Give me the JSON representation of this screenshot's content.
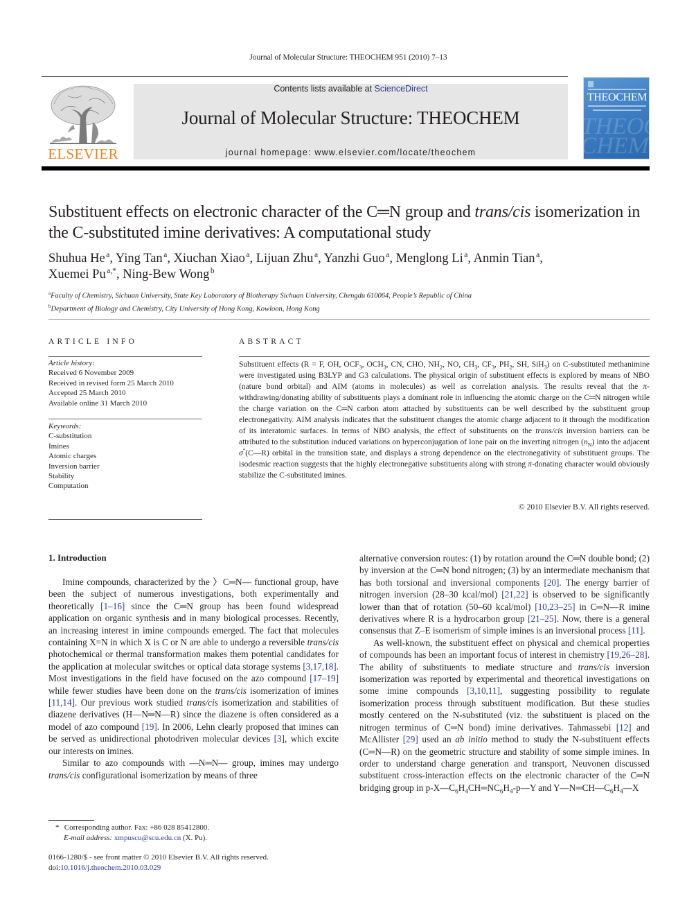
{
  "running_head": "Journal of Molecular Structure: THEOCHEM 951 (2010) 7–13",
  "masthead": {
    "contents_prefix": "Contents lists available at ",
    "contents_link": "ScienceDirect",
    "journal_title": "Journal of Molecular Structure: THEOCHEM",
    "homepage_prefix": "journal homepage: ",
    "homepage_url": "www.elsevier.com/locate/theochem",
    "publisher_logo_text": "ELSEVIER",
    "cover_title": "THEOCHEM",
    "cover_ghost_1": "THEOC",
    "cover_ghost_2": "CHEM"
  },
  "colors": {
    "link": "#2b3a8f",
    "elsevier_orange": "#f0821e",
    "masthead_bg": "#e6e6e6",
    "cover_blue": "#3f7fc4"
  },
  "article": {
    "title_part1": "Substituent effects on electronic character of the C═N group and ",
    "title_italic": "trans/cis",
    "title_part2": " isomerization in the C-substituted imine derivatives: A computational study",
    "authors": [
      {
        "name": "Shuhua He",
        "aff": "a",
        "sep": ", "
      },
      {
        "name": "Ying Tan",
        "aff": "a",
        "sep": ", "
      },
      {
        "name": "Xiuchan Xiao",
        "aff": "a",
        "sep": ", "
      },
      {
        "name": "Lijuan Zhu",
        "aff": "a",
        "sep": ", "
      },
      {
        "name": "Yanzhi Guo",
        "aff": "a",
        "sep": ", "
      },
      {
        "name": "Menglong Li",
        "aff": "a",
        "sep": ", "
      },
      {
        "name": "Anmin Tian",
        "aff": "a",
        "sep": ","
      },
      {
        "name": "Xuemei Pu",
        "aff": "a,*",
        "sep": ", "
      },
      {
        "name": "Ning-Bew Wong",
        "aff": "b",
        "sep": ""
      }
    ],
    "affiliations": [
      {
        "mark": "a",
        "text": "Faculty of Chemistry, Sichuan University, State Key Laboratory of Biotherapy Sichuan University, Chengdu 610064, People’s Republic of China"
      },
      {
        "mark": "b",
        "text": "Department of Biology and Chemistry, City University of Hong Kong, Kowloon, Hong Kong"
      }
    ]
  },
  "article_info": {
    "heading": "ARTICLE INFO",
    "history_label": "Article history:",
    "history": [
      "Received 6 November 2009",
      "Received in revised form 25 March 2010",
      "Accepted 25 March 2010",
      "Available online 31 March 2010"
    ],
    "keywords_label": "Keywords:",
    "keywords": [
      "C-substitution",
      "Imines",
      "Atomic charges",
      "Inversion barrier",
      "Stability",
      "Computation"
    ]
  },
  "abstract": {
    "heading": "ABSTRACT",
    "copyright": "© 2010 Elsevier B.V. All rights reserved."
  },
  "introduction": {
    "heading": "1. Introduction"
  },
  "footnotes": {
    "star": "*",
    "corresponding": "Corresponding author. Fax: +86 028 85412800.",
    "email_label": "E-mail address:",
    "email": "xmpuscu@scu.edu.cn",
    "email_suffix": " (X. Pu).",
    "front_matter": "0166-1280/$ - see front matter © 2010 Elsevier B.V. All rights reserved.",
    "doi_prefix": "doi:",
    "doi": "10.1016/j.theochem.2010.03.029"
  }
}
